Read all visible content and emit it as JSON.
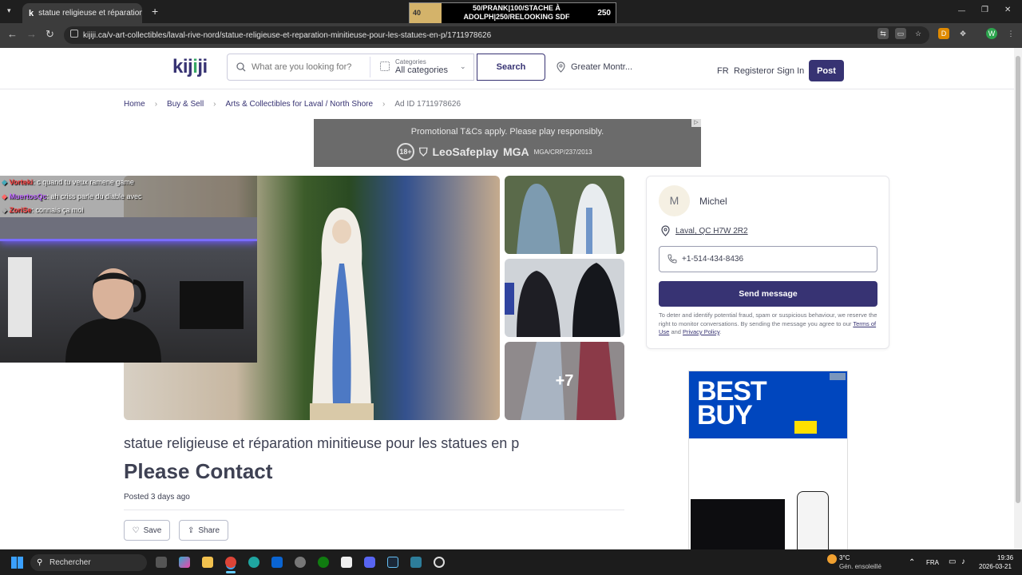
{
  "browser": {
    "tab_title": "statue religieuse et réparation ...",
    "tab_favicon": "k",
    "url": "kijiji.ca/v-art-collectibles/laval-rive-nord/statue-religieuse-et-reparation-minitieuse-pour-les-statues-en-p/1711978626",
    "new_tab": "+",
    "close": "✕",
    "minimize": "—",
    "maximize": "❐",
    "window_close": "✕"
  },
  "stream_banner": {
    "left": "40",
    "text": "50/PRANK|100/STACHE À ADOLPH|250/RELOOKING SDF",
    "right": "250"
  },
  "header": {
    "logo_a": "kij",
    "logo_b": "i",
    "logo_c": "ji",
    "search_placeholder": "What are you looking for?",
    "categories_label": "Categories",
    "categories_value": "All categories",
    "search_button": "Search",
    "location": "Greater Montr...",
    "lang": "FR",
    "register": "Register",
    "or": "or",
    "signin": "Sign In",
    "post": "Post"
  },
  "breadcrumb": {
    "home": "Home",
    "buysell": "Buy & Sell",
    "category": "Arts & Collectibles for Laval / North Shore",
    "ad_id": "Ad ID 1711978626",
    "sep": "›"
  },
  "promo": {
    "line1": "Promotional T&Cs apply. Please play responsibly.",
    "age": "18+",
    "brand1": "LeoSafeplay",
    "brand2": "MGA",
    "license": "MGA/CRP/237/2013"
  },
  "gallery": {
    "more": "+7"
  },
  "chat": [
    {
      "user": "Vorteki",
      "msg": ": c quand tu veux ramene game",
      "color": "#ff4444"
    },
    {
      "user": "MuertosQc",
      "msg": ": ah criss parle du diable avec",
      "color": "#c06cff"
    },
    {
      "user": "ZoriSe",
      "msg": ": connais ça moi",
      "color": "#ff4444"
    }
  ],
  "listing": {
    "title": "statue religieuse et réparation minitieuse pour les statues en p",
    "price": "Please Contact",
    "posted": "Posted 3 days ago",
    "save": "Save",
    "share": "Share"
  },
  "seller": {
    "initial": "M",
    "name": "Michel",
    "location": "Laval, QC H7W 2R2",
    "phone": "+1-514-434-8436",
    "send": "Send message",
    "disclaimer": "To deter and identify potential fraud, spam or suspicious behaviour, we reserve the right to monitor conversations. By sending the message you agree to our",
    "terms": "Terms of Use",
    "and": "and",
    "privacy": "Privacy Policy",
    "period": "."
  },
  "ad": {
    "brand_line1": "BEST",
    "brand_line2": "BUY"
  },
  "taskbar": {
    "search": "Rechercher",
    "temp": "3°C",
    "weather": "Gén. ensoleillé",
    "lang": "FRA",
    "time": "19:36",
    "date": "2026-03-21"
  },
  "colors": {
    "brand": "#373373",
    "accent_green": "#37a864"
  }
}
